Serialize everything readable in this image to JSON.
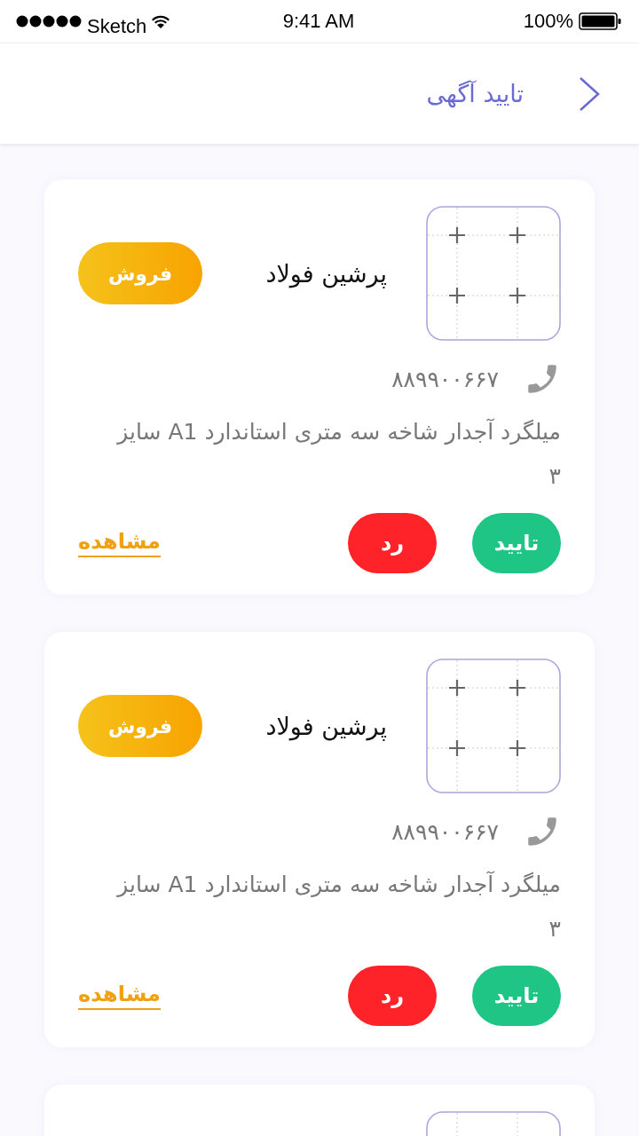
{
  "status_bar": {
    "carrier": "Sketch",
    "time": "9:41 AM",
    "battery": "100%"
  },
  "header": {
    "title": "تایید آگهی"
  },
  "cards": [
    {
      "kind": "full",
      "name": "پرشین فولاد",
      "badge": "فروش",
      "phone": "۸۸۹۹۰۰۶۶۷",
      "description": "میلگرد آجدار شاخه سه متری استاندارد A1 سایز ۳",
      "approve": "تایید",
      "reject": "رد",
      "view": "مشاهده"
    },
    {
      "kind": "full",
      "name": "پرشین فولاد",
      "badge": "فروش",
      "phone": "۸۸۹۹۰۰۶۶۷",
      "description": "میلگرد آجدار شاخه سه متری استاندارد A1 سایز ۳",
      "approve": "تایید",
      "reject": "رد",
      "view": "مشاهده"
    },
    {
      "kind": "stub"
    }
  ]
}
